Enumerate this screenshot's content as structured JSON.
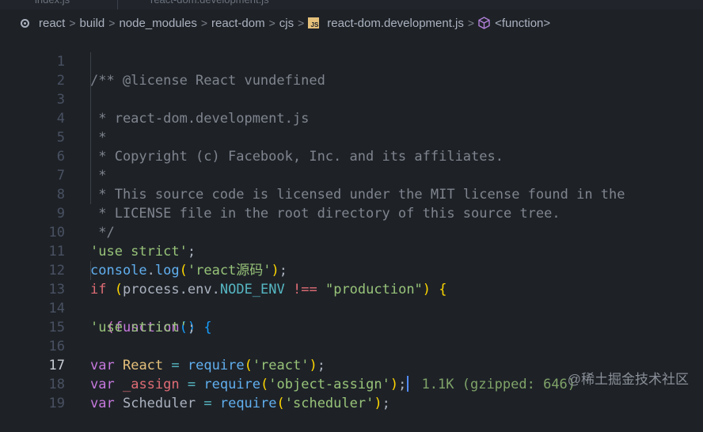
{
  "tabs": [
    {
      "label": "index.js"
    },
    {
      "label": "react-dom.development.js"
    }
  ],
  "breadcrumb": {
    "items": [
      "react",
      "build",
      "node_modules",
      "react-dom",
      "cjs",
      "react-dom.development.js",
      "<function>"
    ],
    "separator": ">"
  },
  "editor": {
    "active_line": 17,
    "line_numbers": [
      "1",
      "2",
      "3",
      "4",
      "5",
      "6",
      "7",
      "8",
      "9",
      "10",
      "11",
      "12",
      "13",
      "14",
      "15",
      "16",
      "17",
      "18",
      "19"
    ],
    "lines": {
      "l1": "/** @license React vundefined",
      "l2": " * react-dom.development.js",
      "l3": " *",
      "l4": " * Copyright (c) Facebook, Inc. and its affiliates.",
      "l5": " *",
      "l6": " * This source code is licensed under the MIT license found in the",
      "l7": " * LICENSE file in the root directory of this source tree.",
      "l8": " */",
      "l10_str": "'use strict'",
      "l11_obj": "console",
      "l11_fn": "log",
      "l11_str": "'react源码'",
      "l12_kw": "if",
      "l12_obj": "process",
      "l12_prop": "env",
      "l12_const": "NODE_ENV",
      "l12_op": "!==",
      "l12_str": "\"production\"",
      "l13_kw": "function",
      "l14_str": "'use strict'",
      "l16_kw": "var",
      "l16_name": "React",
      "l16_fn": "require",
      "l16_str": "'react'",
      "l17_kw": "var",
      "l17_name": "_assign",
      "l17_fn": "require",
      "l17_str": "'object-assign'",
      "l17_size": "1.1K (gzipped: 646)",
      "l18_kw": "var",
      "l18_name": "Scheduler",
      "l18_fn": "require",
      "l18_str": "'scheduler'"
    }
  },
  "watermark": "@稀土掘金技术社区",
  "colors": {
    "background": "#1e2227",
    "comment": "#7f848e",
    "string": "#98c379",
    "keyword": "#c678dd",
    "function": "#61afef",
    "variable": "#e5c07b"
  }
}
